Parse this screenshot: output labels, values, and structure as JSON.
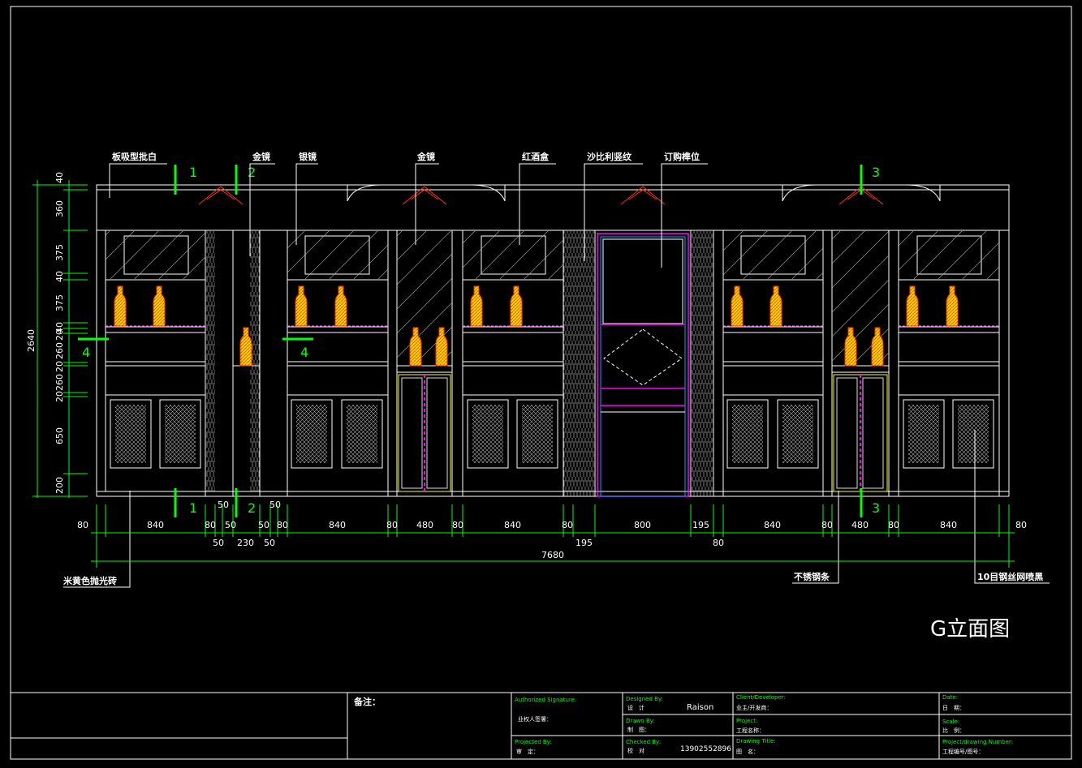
{
  "title": "G立面图",
  "labels": {
    "l1": "板吸型批白",
    "l2": "金镜",
    "l3": "银镜",
    "l4": "金镜",
    "l5": "红酒盒",
    "l6": "沙比利竖纹",
    "l7": "订购榫位",
    "b1": "米黄色抛光砖",
    "b2": "不锈钢条",
    "b3": "10目钢丝网喷黑"
  },
  "markers": {
    "m1": "1",
    "m2": "2",
    "m3": "3",
    "m4": "4"
  },
  "vdims": {
    "total": "2640",
    "segs": [
      "40",
      "360",
      "375",
      "40",
      "375",
      "40",
      "20",
      "260",
      "20",
      "260",
      "20",
      "650",
      "200"
    ]
  },
  "hdims": {
    "row1": [
      "80",
      "840",
      "80",
      "50",
      "50",
      "80",
      "840",
      "80",
      "480",
      "80",
      "840",
      "80",
      "800",
      "195",
      "840",
      "80",
      "480",
      "80",
      "840",
      "80"
    ],
    "row1b": [
      "50",
      "50"
    ],
    "row2": [
      "50",
      "230",
      "50",
      "195",
      "80"
    ],
    "total": "7680"
  },
  "titleblock": {
    "notes": "备注：",
    "auth": "Authorized Signature:",
    "auth_cn": "业权人签署：",
    "proj_by": "Projected By:",
    "proj_by_cn": "审　定：",
    "designed": "Designed By:",
    "designed_cn": "设　计",
    "designer": "Raison",
    "drawn": "Drawn By:",
    "drawn_cn": "制　图：",
    "checked": "Checked By:",
    "checked_cn": "校　对",
    "phone": "13902552896",
    "client": "Client/Developer:",
    "client_cn": "业主/开发商：",
    "project": "Project:",
    "project_cn": "工程名称：",
    "dtitle": "Drawing Title:",
    "dtitle_cn": "图　名：",
    "date": "Date:",
    "date_cn": "日　期：",
    "scale": "Scale:",
    "scale_cn": "比　例：",
    "pnum": "Project/drawing Number:",
    "pnum_cn": "工程编号/图号："
  },
  "colors": {
    "background": "#000000",
    "line": "#ffffff",
    "dimension": "#00ff00",
    "frame_accent": "#ff00ff",
    "bottle": "#ffd700",
    "lamp": "#ff3300"
  }
}
